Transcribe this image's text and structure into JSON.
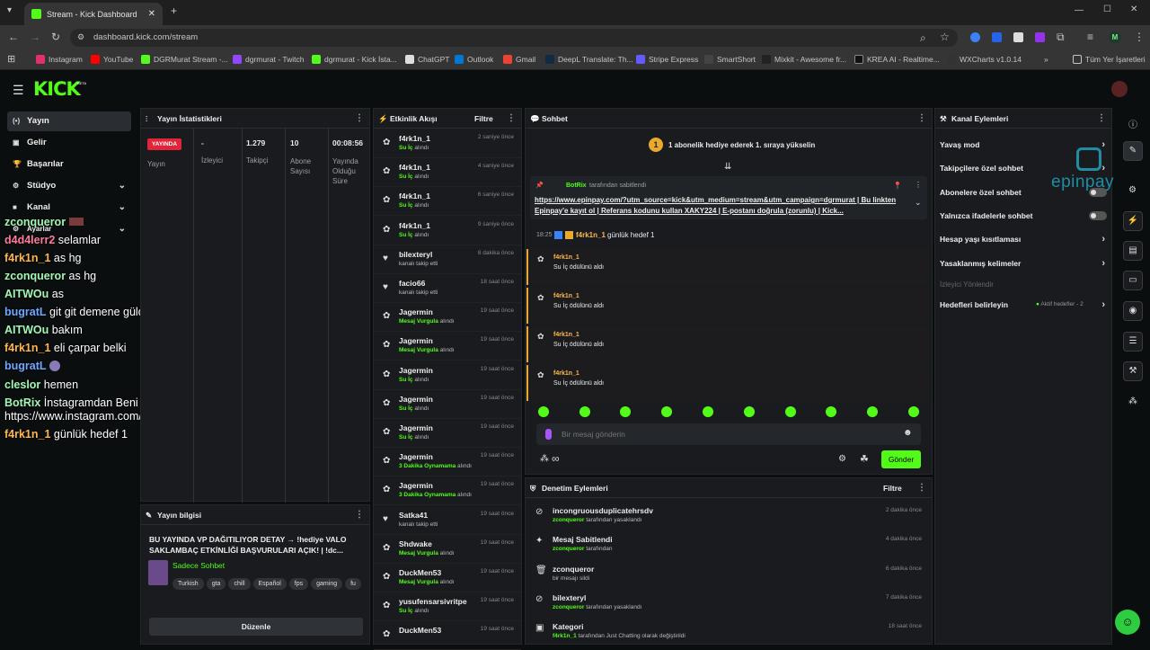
{
  "browser": {
    "tab_title": "Stream - Kick Dashboard",
    "url": "dashboard.kick.com/stream",
    "bookmarks": [
      "Instagram",
      "YouTube",
      "DGRMurat Stream -...",
      "dgrmurat - Twitch",
      "dgrmurat - Kick İsta...",
      "ChatGPT",
      "Outlook",
      "Gmail",
      "DeepL Translate: Th...",
      "Stripe Express",
      "SmartShort",
      "Mixkit - Awesome fr...",
      "KREA AI - Realtime...",
      "WXCharts v1.0.14"
    ],
    "all_bookmarks": "Tüm Yer İşaretleri",
    "profile_initial": "M"
  },
  "logo": "KICK",
  "logo_badge": "BETA",
  "sidebar": [
    "Yayın",
    "Gelir",
    "Başarılar",
    "Stüdyo",
    "Kanal",
    "Ayarlar"
  ],
  "overlay_chat": [
    {
      "user": "zconqueror",
      "msg": "",
      "color": "#a3f7b5"
    },
    {
      "user": "d4d4lerr2",
      "msg": "selamlar",
      "color": "#ff7a9c"
    },
    {
      "user": "f4rk1n_1",
      "msg": "as hg",
      "color": "#ffb84d"
    },
    {
      "user": "zconqueror",
      "msg": "as hg",
      "color": "#a3f7b5"
    },
    {
      "user": "AITWOu",
      "msg": "as",
      "color": "#a3f7b5"
    },
    {
      "user": "bugratL",
      "msg": "git git demene güldüm",
      "color": "#6fa8ff"
    },
    {
      "user": "AITWOu",
      "msg": "bakım",
      "color": "#a3f7b5"
    },
    {
      "user": "f4rk1n_1",
      "msg": "eli çarpar belki",
      "color": "#ffb84d"
    },
    {
      "user": "bugratL",
      "msg": "",
      "color": "#6fa8ff"
    },
    {
      "user": "cleslor",
      "msg": "hemen",
      "color": "#a3f7b5"
    },
    {
      "user": "BotRix",
      "msg": "İnstagramdan Beni Takip Edebilirsiniz!",
      "color": "#a3f7b5"
    },
    {
      "user": "",
      "msg": "https://www.instagram.com/dgr.murat/",
      "color": "#fff"
    },
    {
      "user": "f4rk1n_1",
      "msg": "günlük hedef 1",
      "color": "#ffb84d"
    }
  ],
  "stats": {
    "title": "Yayın İstatistikleri",
    "live": "YAYINDA",
    "status_label": "Yayın",
    "cols": [
      {
        "v": "-",
        "l": "İzleyici"
      },
      {
        "v": "1.279",
        "l": "Takipçi"
      },
      {
        "v": "10",
        "l": "Abone Sayısı"
      },
      {
        "v": "00:08:56",
        "l": "Yayında Olduğu Süre"
      }
    ]
  },
  "info": {
    "title": "Yayın bilgisi",
    "text": "BU YAYINDA VP DAĞITILIYOR DETAY → !hediye VALO SAKLAMBAÇ ETKİNLİĞİ BAŞVURULARI AÇIK! | !dc...",
    "category": "Sadece Sohbet",
    "tags": [
      "Turkish",
      "gta",
      "chill",
      "Español",
      "fps",
      "gaming",
      "fu"
    ],
    "edit": "Düzenle"
  },
  "activity": {
    "title": "Etkinlik Akışı",
    "filter": "Filtre",
    "items": [
      {
        "n": "f4rk1n_1",
        "h": "Su İç",
        "s": "alındı",
        "t": "2 saniye önce",
        "i": "gift"
      },
      {
        "n": "f4rk1n_1",
        "h": "Su İç",
        "s": "alındı",
        "t": "4 saniye önce",
        "i": "gift"
      },
      {
        "n": "f4rk1n_1",
        "h": "Su İç",
        "s": "alındı",
        "t": "6 saniye önce",
        "i": "gift"
      },
      {
        "n": "f4rk1n_1",
        "h": "Su İç",
        "s": "alındı",
        "t": "9 saniye önce",
        "i": "gift"
      },
      {
        "n": "bilexteryl",
        "h": "",
        "s": "kanalı takip etti",
        "t": "8 dakika önce",
        "i": "heart"
      },
      {
        "n": "facio66",
        "h": "",
        "s": "kanalı takip etti",
        "t": "18 saat önce",
        "i": "heart"
      },
      {
        "n": "Jagermin",
        "h": "Mesaj Vurgula",
        "s": "alındı",
        "t": "19 saat önce",
        "i": "gift"
      },
      {
        "n": "Jagermin",
        "h": "Mesaj Vurgula",
        "s": "alındı",
        "t": "19 saat önce",
        "i": "gift"
      },
      {
        "n": "Jagermin",
        "h": "Su İç",
        "s": "alındı",
        "t": "19 saat önce",
        "i": "gift"
      },
      {
        "n": "Jagermin",
        "h": "Su İç",
        "s": "alındı",
        "t": "19 saat önce",
        "i": "gift"
      },
      {
        "n": "Jagermin",
        "h": "Su İç",
        "s": "alındı",
        "t": "19 saat önce",
        "i": "gift"
      },
      {
        "n": "Jagermin",
        "h": "3 Dakika Oynamama",
        "s": "alındı",
        "t": "19 saat önce",
        "i": "gift"
      },
      {
        "n": "Jagermin",
        "h": "3 Dakika Oynamama",
        "s": "alındı",
        "t": "19 saat önce",
        "i": "gift"
      },
      {
        "n": "Satka41",
        "h": "",
        "s": "kanalı takip etti",
        "t": "19 saat önce",
        "i": "heart"
      },
      {
        "n": "Shdwake",
        "h": "Mesaj Vurgula",
        "s": "alındı",
        "t": "19 saat önce",
        "i": "gift"
      },
      {
        "n": "DuckMen53",
        "h": "Mesaj Vurgula",
        "s": "alındı",
        "t": "19 saat önce",
        "i": "gift"
      },
      {
        "n": "yusufensarsivritpe",
        "h": "Su İç",
        "s": "alındı",
        "t": "19 saat önce",
        "i": "gift"
      },
      {
        "n": "DuckMen53",
        "h": "",
        "s": "",
        "t": "19 saat önce",
        "i": "gift"
      }
    ]
  },
  "chat": {
    "title": "Sohbet",
    "goal_num": "1",
    "goal": "1 abonelik hediye ederek 1. sıraya yükselin",
    "pin_by": "BotRix",
    "pin_suffix": "tarafından sabitlendi",
    "pin_text": "https://www.epinpay.com/?utm_source=kick&utm_medium=stream&utm_campaign=dgrmurat | Bu linkten Epinpay'e kayıt ol | Referans kodunu kullan XAKY224 | E-postanı doğrula (zorunlu) | Kick...",
    "msg_time": "18:25",
    "msg_user": "f4rk1n_1",
    "msg_text": "günlük hedef 1",
    "redeems": [
      {
        "u": "f4rk1n_1",
        "r": "Su İç ödülünü aldı"
      },
      {
        "u": "f4rk1n_1",
        "r": "Su İç ödülünü aldı"
      },
      {
        "u": "f4rk1n_1",
        "r": "Su İç ödülünü aldı"
      },
      {
        "u": "f4rk1n_1",
        "r": "Su İç ödülünü aldı"
      }
    ],
    "placeholder": "Bir mesaj gönderin",
    "send": "Gönder",
    "infinity": "∞"
  },
  "mod": {
    "title": "Denetim Eylemleri",
    "filter": "Filtre",
    "items": [
      {
        "a": "incongruousduplicatehrsdv",
        "by": "zconqueror",
        "s": "tarafından yasaklandı",
        "t": "2 dakika önce",
        "i": "⊘"
      },
      {
        "a": "Mesaj Sabitlendi",
        "by": "zconqueror",
        "s": "tarafından",
        "t": "4 dakika önce",
        "i": "✦"
      },
      {
        "a": "zconqueror",
        "by": "",
        "s": "bir mesajı sildi",
        "t": "6 dakika önce",
        "i": "🗑"
      },
      {
        "a": "bilexteryl",
        "by": "zconqueror",
        "s": "tarafından yasaklandı",
        "t": "7 dakika önce",
        "i": "⊘"
      },
      {
        "a": "Kategori",
        "by": "f4rk1n_1",
        "s": "tarafından Just Chatting olarak değiştirildi",
        "t": "18 saat önce",
        "i": "▣"
      }
    ]
  },
  "channel": {
    "title": "Kanal Eylemleri",
    "items": [
      {
        "l": "Yavaş mod",
        "k": "chev"
      },
      {
        "l": "Takipçilere özel sohbet",
        "k": "chev"
      },
      {
        "l": "Abonelere özel sohbet",
        "k": "tog"
      },
      {
        "l": "Yalnızca ifadelerle sohbet",
        "k": "tog"
      },
      {
        "l": "Hesap yaşı kısıtlaması",
        "k": "chev"
      },
      {
        "l": "Yasaklanmış kelimeler",
        "k": "chev"
      }
    ],
    "redirect": "İzleyici Yönlendir",
    "goals": "Hedefleri belirleyin",
    "goals_status": "Aktif hedefler - 2",
    "watermark": "epinpay"
  }
}
